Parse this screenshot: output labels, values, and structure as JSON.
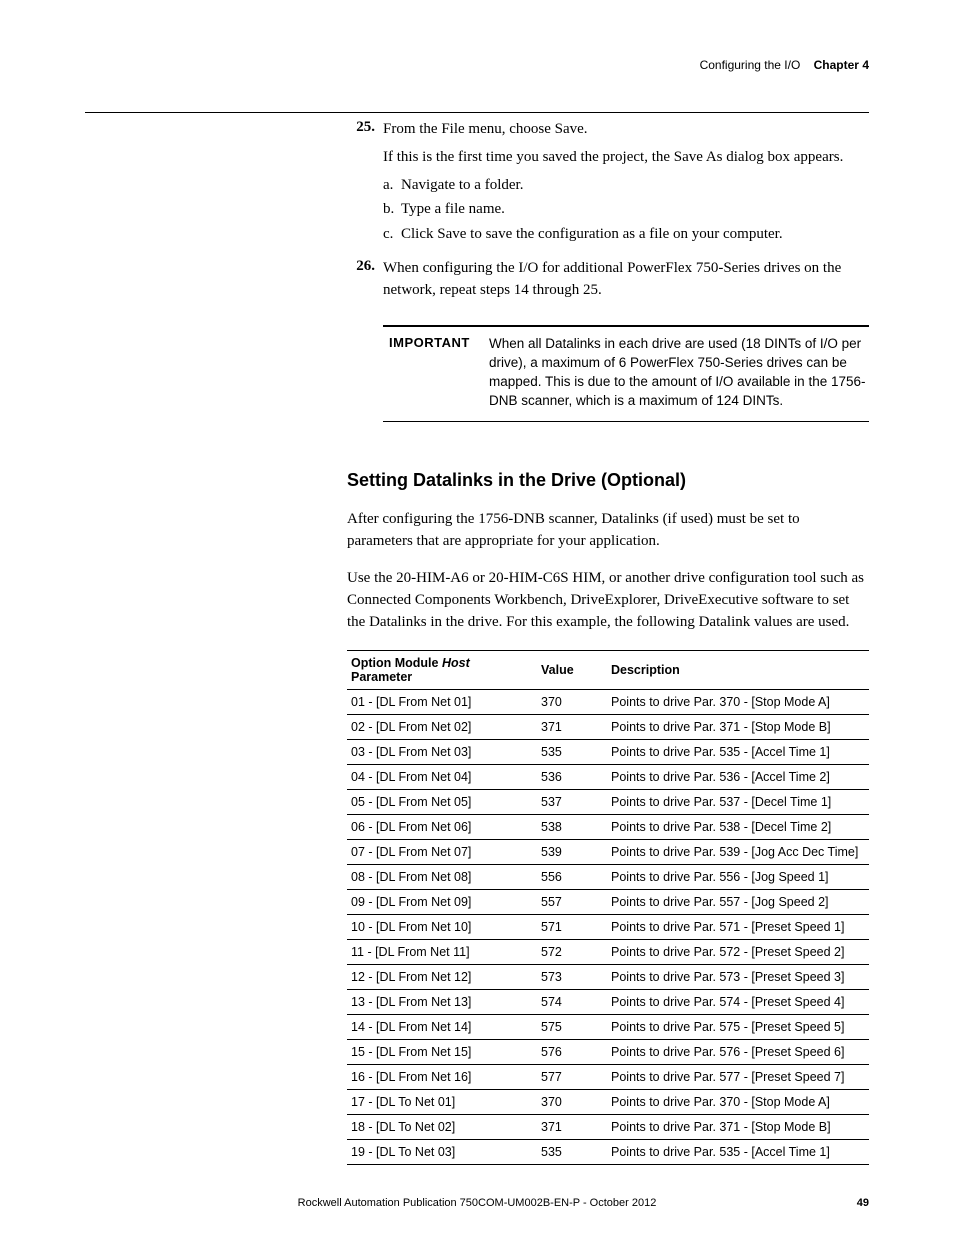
{
  "header": {
    "section": "Configuring the I/O",
    "chapter": "Chapter 4"
  },
  "steps": [
    {
      "num": "25.",
      "lead": "From the File menu, choose Save.",
      "after": "If this is the first time you saved the project, the Save As dialog box appears.",
      "subs": [
        {
          "letter": "a.",
          "text": "Navigate to a folder."
        },
        {
          "letter": "b.",
          "text": "Type a file name."
        },
        {
          "letter": "c.",
          "text": "Click Save to save the configuration as a file on your computer."
        }
      ]
    },
    {
      "num": "26.",
      "lead": "When configuring the I/O for additional PowerFlex 750-Series drives on the network, repeat steps 14 through 25."
    }
  ],
  "important": {
    "label": "IMPORTANT",
    "text": "When all Datalinks in each drive are used (18 DINTs of I/O per drive), a maximum of 6 PowerFlex 750-Series drives can be mapped. This is due to the amount of I/O available in the 1756-DNB scanner, which is a maximum of 124 DINTs."
  },
  "section_heading": "Setting Datalinks in the Drive (Optional)",
  "paras": [
    "After configuring the 1756-DNB scanner, Datalinks (if used) must be set to parameters that are appropriate for your application.",
    "Use the 20-HIM-A6 or 20-HIM-C6S HIM, or another drive configuration tool such as Connected Components Workbench, DriveExplorer, DriveExecutive software to set the Datalinks in the drive. For this example, the following Datalink values are used."
  ],
  "table": {
    "headers": {
      "param_pre": "Option Module ",
      "param_italic": "Host",
      "param_post": " Parameter",
      "value": "Value",
      "desc": "Description"
    },
    "rows": [
      {
        "p": "01 - [DL From Net 01]",
        "v": "370",
        "d": "Points to drive Par. 370 - [Stop Mode A]"
      },
      {
        "p": "02 - [DL From Net 02]",
        "v": "371",
        "d": "Points to drive Par. 371 - [Stop Mode B]"
      },
      {
        "p": "03 - [DL From Net 03]",
        "v": "535",
        "d": "Points to drive Par. 535 - [Accel Time 1]"
      },
      {
        "p": "04 - [DL From Net 04]",
        "v": "536",
        "d": "Points to drive Par. 536 - [Accel Time 2]"
      },
      {
        "p": "05 - [DL From Net 05]",
        "v": "537",
        "d": "Points to drive Par. 537 - [Decel Time 1]"
      },
      {
        "p": "06 - [DL From Net 06]",
        "v": "538",
        "d": "Points to drive Par. 538 - [Decel Time 2]"
      },
      {
        "p": "07 - [DL From Net 07]",
        "v": "539",
        "d": "Points to drive Par. 539 - [Jog Acc Dec Time]"
      },
      {
        "p": "08 - [DL From Net 08]",
        "v": "556",
        "d": "Points to drive Par. 556 - [Jog Speed 1]"
      },
      {
        "p": "09 - [DL From Net 09]",
        "v": "557",
        "d": "Points to drive Par. 557 - [Jog Speed 2]"
      },
      {
        "p": "10 - [DL From Net 10]",
        "v": "571",
        "d": "Points to drive Par. 571 - [Preset Speed 1]"
      },
      {
        "p": "11 - [DL From Net 11]",
        "v": "572",
        "d": "Points to drive Par. 572 - [Preset Speed 2]"
      },
      {
        "p": "12 - [DL From Net 12]",
        "v": "573",
        "d": "Points to drive Par. 573 - [Preset Speed 3]"
      },
      {
        "p": "13 - [DL From Net 13]",
        "v": "574",
        "d": "Points to drive Par. 574 - [Preset Speed 4]"
      },
      {
        "p": "14 - [DL From Net 14]",
        "v": "575",
        "d": "Points to drive Par. 575 - [Preset Speed 5]"
      },
      {
        "p": "15 - [DL From Net 15]",
        "v": "576",
        "d": "Points to drive Par. 576 - [Preset Speed 6]"
      },
      {
        "p": "16 - [DL From Net 16]",
        "v": "577",
        "d": "Points to drive Par. 577 - [Preset Speed 7]"
      },
      {
        "p": "17 - [DL To Net 01]",
        "v": "370",
        "d": "Points to drive Par. 370 - [Stop Mode A]"
      },
      {
        "p": "18 - [DL To Net 02]",
        "v": "371",
        "d": "Points to drive Par. 371 - [Stop Mode B]"
      },
      {
        "p": "19 - [DL To Net 03]",
        "v": "535",
        "d": "Points to drive Par. 535 - [Accel Time 1]"
      }
    ]
  },
  "footer": {
    "publication": "Rockwell Automation Publication 750COM-UM002B-EN-P - October 2012",
    "page": "49"
  }
}
